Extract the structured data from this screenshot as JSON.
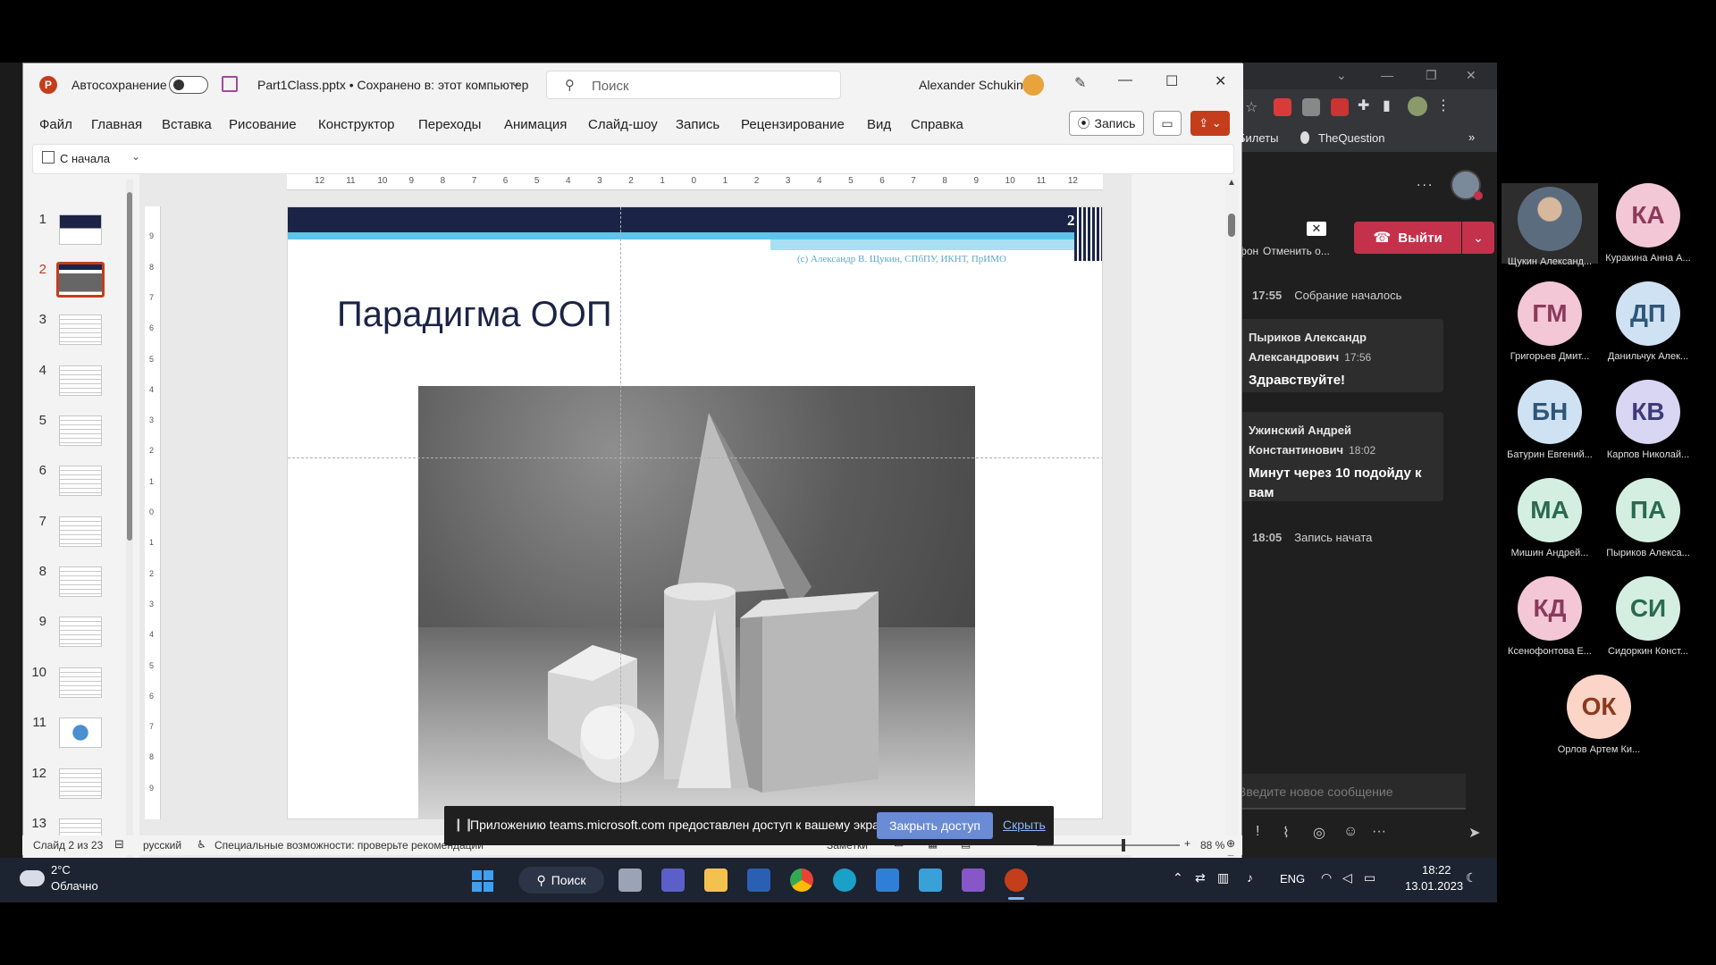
{
  "ppt": {
    "autosave_label": "Автосохранение",
    "file_title": "Part1Class.pptx • Сохранено в: этот компьютер",
    "search_placeholder": "Поиск",
    "user_name": "Alexander Schukin",
    "menu": [
      "Файл",
      "Главная",
      "Вставка",
      "Рисование",
      "Конструктор",
      "Переходы",
      "Анимация",
      "Слайд-шоу",
      "Запись",
      "Рецензирование",
      "Вид",
      "Справка"
    ],
    "record_button": "Запись",
    "from_start_label": "С начала",
    "slide_numbers": [
      "1",
      "2",
      "3",
      "4",
      "5",
      "6",
      "7",
      "8",
      "9",
      "10",
      "11",
      "12",
      "13"
    ],
    "ruler_h": [
      "12",
      "11",
      "10",
      "9",
      "8",
      "7",
      "6",
      "5",
      "4",
      "3",
      "2",
      "1",
      "0",
      "1",
      "2",
      "3",
      "4",
      "5",
      "6",
      "7",
      "8",
      "9",
      "10",
      "11",
      "12"
    ],
    "ruler_v": [
      "9",
      "8",
      "7",
      "6",
      "5",
      "4",
      "3",
      "2",
      "1",
      "0",
      "1",
      "2",
      "3",
      "4",
      "5",
      "6",
      "7",
      "8",
      "9"
    ],
    "slide": {
      "page_number": "2",
      "copyright": "(c) Александр В. Щукин, СПбПУ, ИКНТ, ПрИМО",
      "title": "Парадигма ООП"
    },
    "status": {
      "slide_of": "Слайд 2 из 23",
      "language": "русский",
      "accessibility": "Специальные возможности: проверьте рекомендации",
      "notes": "Заметки",
      "zoom": "88 %"
    }
  },
  "share_bar": {
    "message": "Приложению teams.microsoft.com предоставлен доступ к вашему экрану.",
    "stop_button": "Закрыть доступ",
    "hide_link": "Скрыть"
  },
  "browser": {
    "bookmark_1": "Билеты",
    "bookmark_2": "TheQuestion",
    "more": "»"
  },
  "teams": {
    "toolbar_label_1": "фон",
    "toolbar_label_2": "Отменить о...",
    "leave_button": "Выйти",
    "events": [
      {
        "time": "17:55",
        "text": "Собрание началось"
      },
      {
        "time": "18:05",
        "text": "Запись начата"
      }
    ],
    "messages": [
      {
        "author": "Пыриков Александр Александрович",
        "time": "17:56",
        "text": "Здравствуйте!"
      },
      {
        "author": "Ужинский Андрей Константинович",
        "time": "18:02",
        "text": "Минут через 10 подойду к вам"
      }
    ],
    "compose_placeholder": "Введите новое сообщение",
    "more_dots": "...",
    "participants": [
      {
        "initials": "",
        "name": "Щукин Александ...",
        "color": "#6b7f92",
        "photo": true
      },
      {
        "initials": "КА",
        "name": "Куракина Анна А...",
        "color": "#f3c7d6",
        "text_color": "#8b3a5a"
      },
      {
        "initials": "ГМ",
        "name": "Григорьев Дмит...",
        "color": "#f3c7d6",
        "text_color": "#8b3a5a"
      },
      {
        "initials": "ДП",
        "name": "Данильчук Алек...",
        "color": "#cfe2f3",
        "text_color": "#2f5677"
      },
      {
        "initials": "БН",
        "name": "Батурин Евгений...",
        "color": "#cfe2f3",
        "text_color": "#2f5677"
      },
      {
        "initials": "КВ",
        "name": "Карпов Николай...",
        "color": "#d9d6f3",
        "text_color": "#3f3a7a"
      },
      {
        "initials": "МА",
        "name": "Мишин Андрей...",
        "color": "#d4efe2",
        "text_color": "#2b6a4f"
      },
      {
        "initials": "ПА",
        "name": "Пыриков Алекса...",
        "color": "#d4efe2",
        "text_color": "#2b6a4f"
      },
      {
        "initials": "КД",
        "name": "Ксенофонтова Е...",
        "color": "#f3c7d6",
        "text_color": "#8b3a5a"
      },
      {
        "initials": "СИ",
        "name": "Сидоркин Конст...",
        "color": "#d4efe2",
        "text_color": "#2b6a4f"
      },
      {
        "initials": "ОК",
        "name": "Орлов Артем Ки...",
        "color": "#fbd5c7",
        "text_color": "#8a3a1f"
      }
    ]
  },
  "taskbar": {
    "weather_temp": "2°C",
    "weather_text": "Облачно",
    "search_label": "Поиск",
    "lang": "ENG",
    "time": "18:22",
    "date": "13.01.2023"
  },
  "colors": {
    "ppt_accent": "#c43e1c",
    "slide_header": "#1b2446",
    "slide_stripe": "#5ec4ec",
    "teams_leave": "#c4314b",
    "share_button": "#6a8bd6"
  }
}
